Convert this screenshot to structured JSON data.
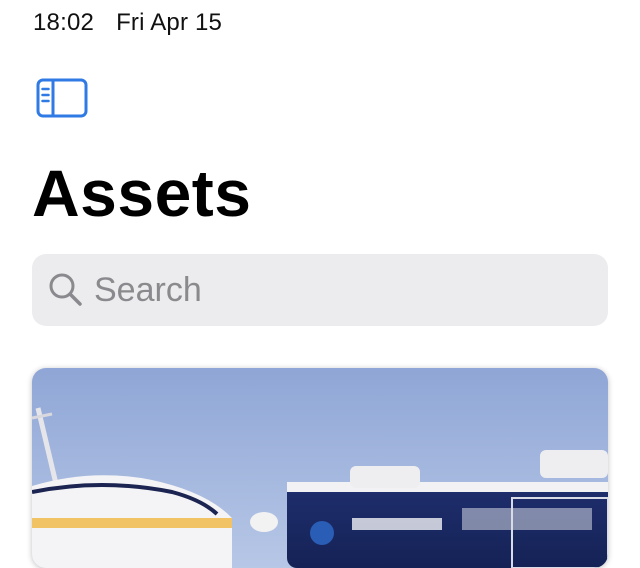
{
  "status_bar": {
    "time": "18:02",
    "date": "Fri Apr 15"
  },
  "toolbar": {
    "sidebar_toggle_icon": "sidebar-left-icon",
    "accent_color": "#2f7ae5"
  },
  "page": {
    "title": "Assets"
  },
  "search": {
    "placeholder": "Search",
    "value": "",
    "icon": "search-icon"
  },
  "assets": {
    "items": [
      {
        "type": "photo",
        "thumbnail_subject": "vehicles-photo"
      }
    ]
  },
  "colors": {
    "search_background": "#ececee",
    "placeholder": "#8a8a8e",
    "title": "#000000"
  }
}
